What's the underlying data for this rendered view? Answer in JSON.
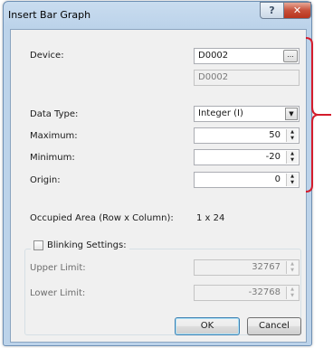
{
  "window": {
    "title": "Insert Bar Graph",
    "help_glyph": "?",
    "close_glyph": "✕"
  },
  "device": {
    "label": "Device:",
    "value": "D0002",
    "readonly_value": "D0002",
    "browse_label": "..."
  },
  "data_type": {
    "label": "Data Type:",
    "value": "Integer (I)"
  },
  "maximum": {
    "label": "Maximum:",
    "value": "50"
  },
  "minimum": {
    "label": "Minimum:",
    "value": "-20"
  },
  "origin": {
    "label": "Origin:",
    "value": "0"
  },
  "occupied": {
    "label": "Occupied Area (Row x Column):",
    "value": "1 x 24"
  },
  "blinking": {
    "label": "Blinking Settings:",
    "checked": false,
    "upper_limit": {
      "label": "Upper Limit:",
      "value": "32767"
    },
    "lower_limit": {
      "label": "Lower Limit:",
      "value": "-32768"
    }
  },
  "buttons": {
    "ok": "OK",
    "cancel": "Cancel"
  },
  "colors": {
    "annotation_bracket": "#d41c2c",
    "title_bar": "#bcd3ea"
  },
  "icons": {
    "spin_up": "▲",
    "spin_down": "▼",
    "dropdown": "▼"
  }
}
